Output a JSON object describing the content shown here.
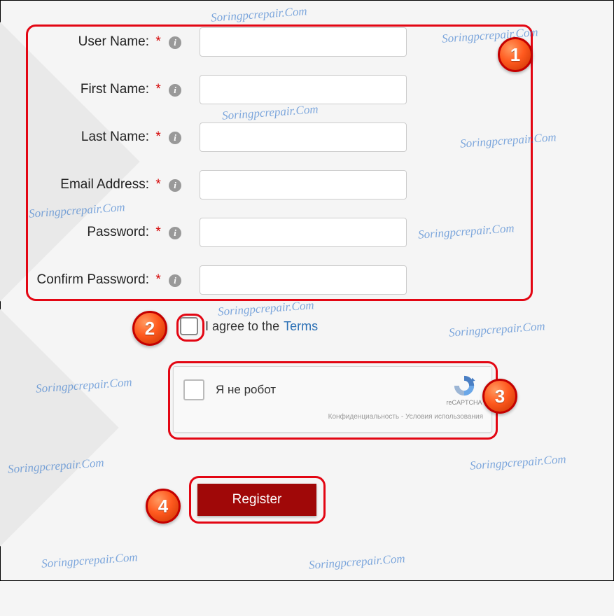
{
  "watermark_text": "Soringpcrepair.Com",
  "badges": {
    "b1": "1",
    "b2": "2",
    "b3": "3",
    "b4": "4"
  },
  "form": {
    "fields": [
      {
        "label": "User Name:"
      },
      {
        "label": "First Name:"
      },
      {
        "label": "Last Name:"
      },
      {
        "label": "Email Address:"
      },
      {
        "label": "Password:"
      },
      {
        "label": "Confirm Password:"
      }
    ],
    "required_mark": "*"
  },
  "terms": {
    "prefix": "I agree to the",
    "link": "Terms"
  },
  "captcha": {
    "label": "Я не робот",
    "brand": "reCAPTCHA",
    "privacy": "Конфиденциальность",
    "sep": " - ",
    "terms": "Условия использования"
  },
  "register_label": "Register"
}
